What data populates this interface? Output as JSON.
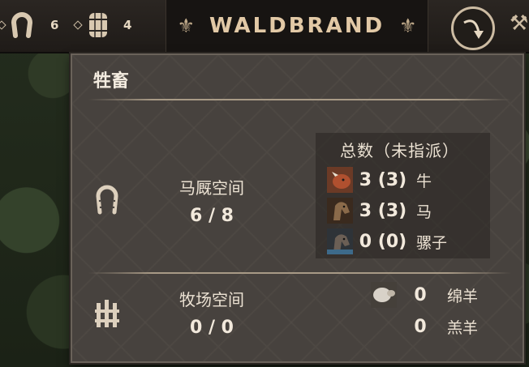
{
  "topbar": {
    "res1_count": "6",
    "res2_count": "4",
    "title": "WALDBRAND"
  },
  "panel": {
    "title": "牲畜",
    "stable": {
      "label": "马厩空间",
      "value": "6 / 8"
    },
    "animals_header": "总数（未指派）",
    "animals": [
      {
        "count": "3 (3)",
        "name": "牛",
        "icon": "cow-portrait"
      },
      {
        "count": "3 (3)",
        "name": "马",
        "icon": "horse-portrait"
      },
      {
        "count": "0 (0)",
        "name": "骡子",
        "icon": "mule-portrait"
      }
    ],
    "pasture": {
      "label": "牧场空间",
      "value": "0 / 0"
    },
    "pasture_animals": [
      {
        "count": "0",
        "name": "绵羊",
        "icon": "sheep-portrait"
      },
      {
        "count": "0",
        "name": "羔羊"
      }
    ]
  },
  "colors": {
    "title_text": "#e2c9a6",
    "panel_bg": "#47423e"
  }
}
